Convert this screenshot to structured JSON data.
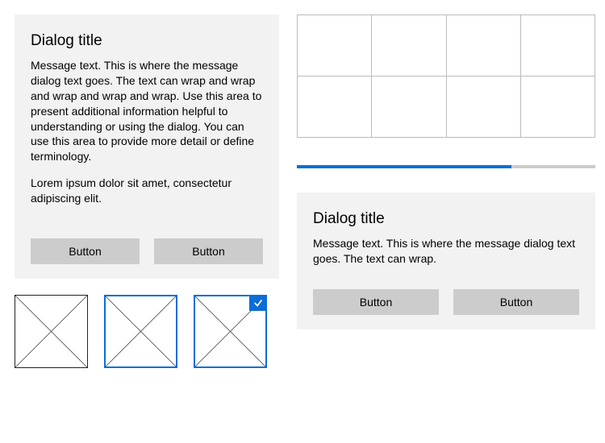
{
  "dialog1": {
    "title": "Dialog title",
    "message1": "Message text. This is where the message dialog text goes. The text can wrap and wrap and wrap and wrap and wrap. Use this area to present additional information helpful to understanding or using the dialog. You can use this area to provide more detail or define terminology.",
    "message2": "Lorem ipsum dolor sit amet, consectetur adipiscing elit.",
    "button1": "Button",
    "button2": "Button"
  },
  "dialog2": {
    "title": "Dialog title",
    "message": "Message text. This is where the message dialog text goes. The text can wrap.",
    "button1": "Button",
    "button2": "Button"
  },
  "thumbnails": {
    "states": [
      "default",
      "selected",
      "selected-check"
    ]
  },
  "grid": {
    "rows": 2,
    "cols": 4
  },
  "progress": {
    "percent": 72
  },
  "colors": {
    "accent": "#0c6dd6"
  }
}
